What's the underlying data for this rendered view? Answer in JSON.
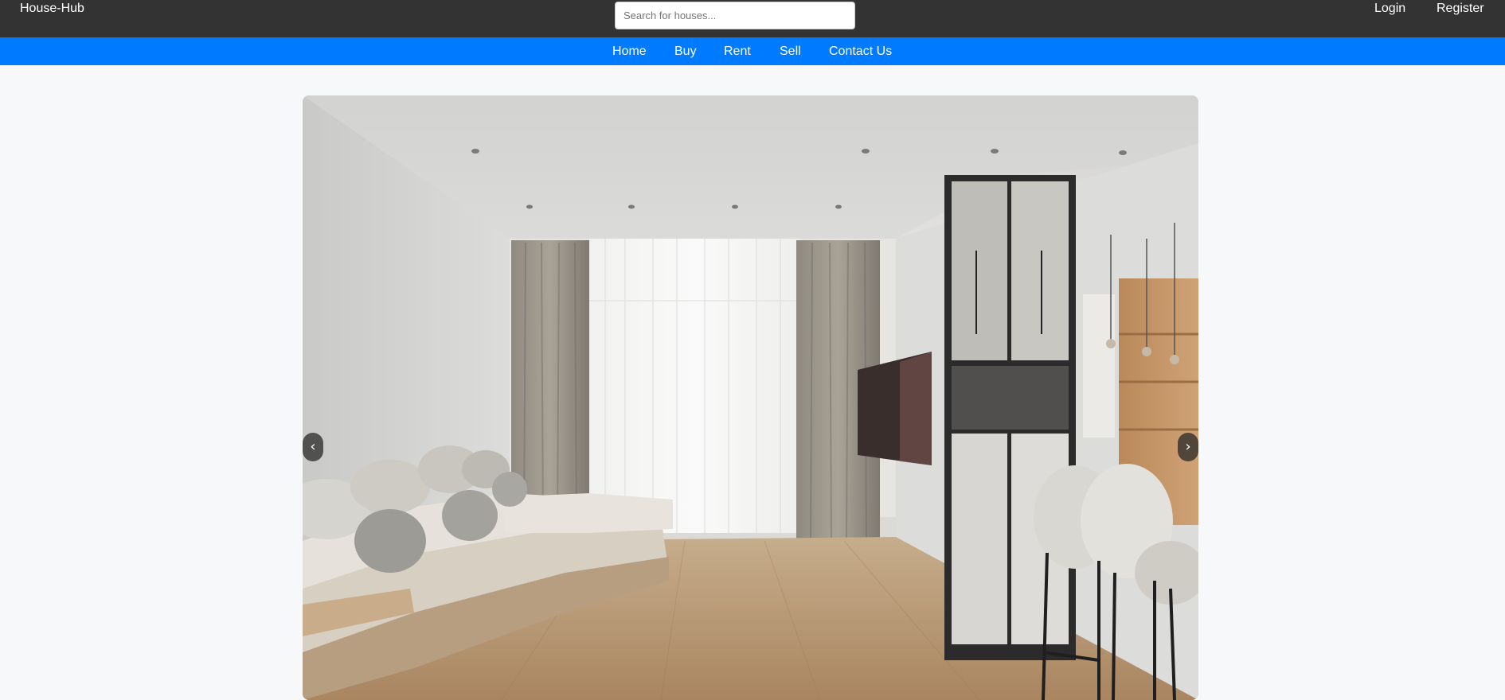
{
  "header": {
    "brand": "House-Hub",
    "search": {
      "placeholder": "Search for houses...",
      "value": ""
    },
    "login_label": "Login",
    "register_label": "Register"
  },
  "nav": {
    "items": [
      {
        "label": "Home"
      },
      {
        "label": "Buy"
      },
      {
        "label": "Rent"
      },
      {
        "label": "Sell"
      },
      {
        "label": "Contact Us"
      }
    ]
  },
  "carousel": {
    "prev_icon": "‹",
    "next_icon": "›",
    "slide_subject": "modern-living-room-photo"
  },
  "colors": {
    "header_bg": "#333333",
    "nav_bg": "#007bff",
    "page_bg": "#f7f8f9"
  }
}
